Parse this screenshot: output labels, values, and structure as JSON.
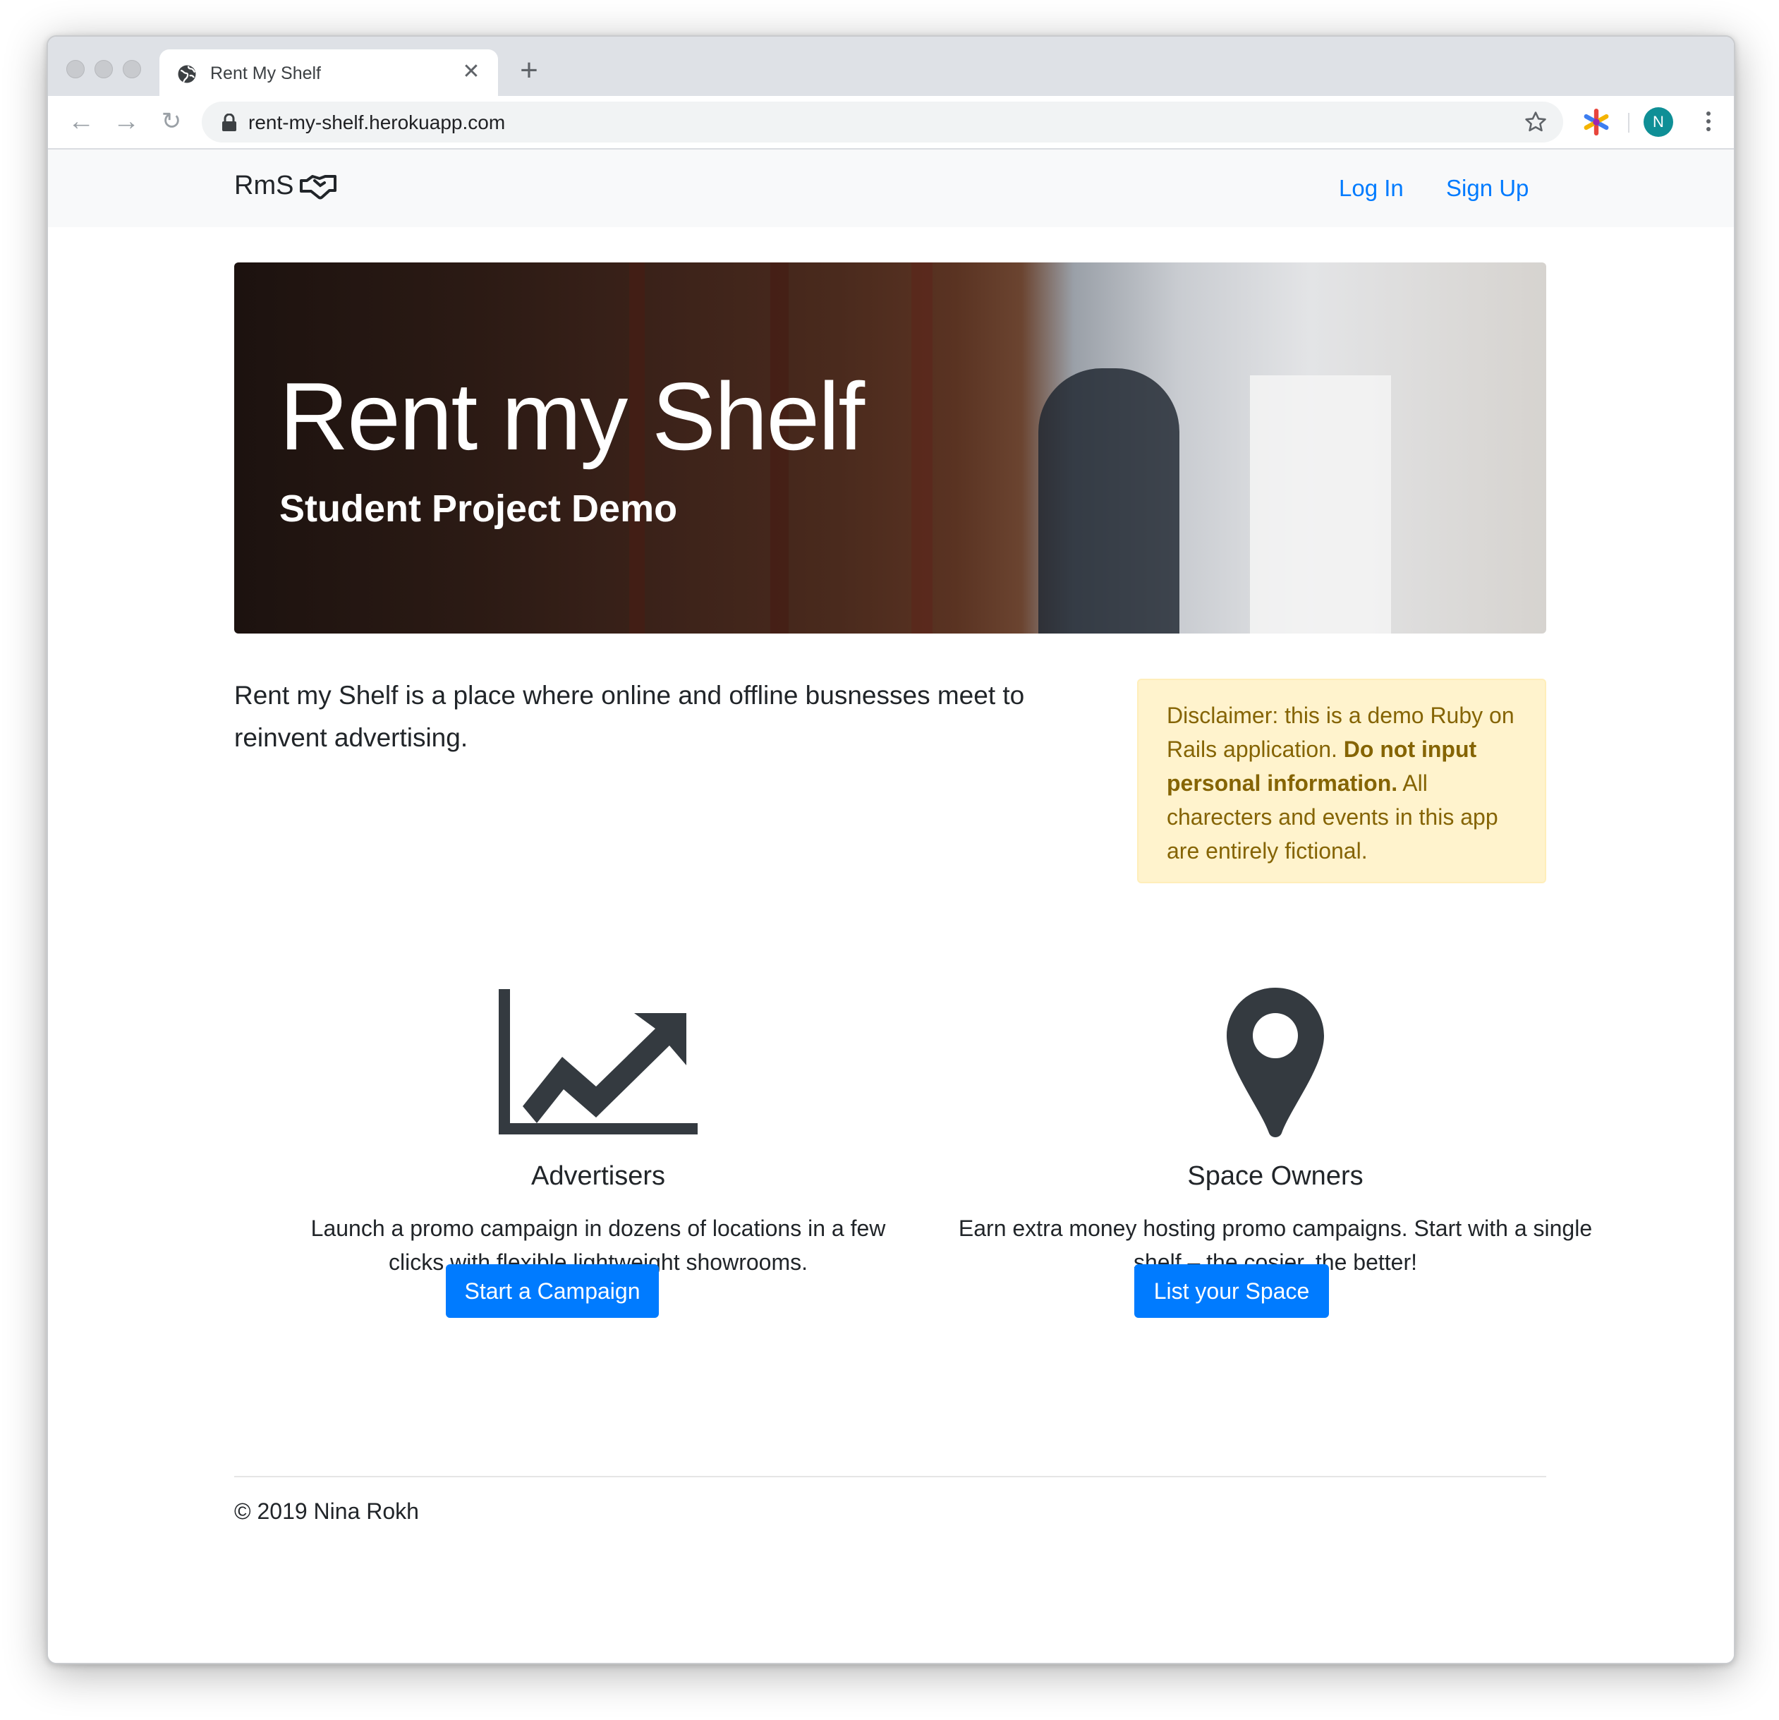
{
  "browser": {
    "tab_title": "Rent My Shelf",
    "url": "rent-my-shelf.herokuapp.com",
    "profile_initial": "N"
  },
  "nav": {
    "brand": "RmS",
    "login": "Log In",
    "signup": "Sign Up"
  },
  "hero": {
    "title": "Rent my Shelf",
    "subtitle": "Student Project Demo"
  },
  "intro": {
    "lead": "Rent my Shelf is a place where online and offline busnesses meet to reinvent advertising."
  },
  "alert": {
    "text_before": "Disclaimer: this is a demo Ruby on Rails application. ",
    "bold": "Do not input personal information.",
    "text_after": " All charecters and events in this app are entirely fictional."
  },
  "features": [
    {
      "icon": "chart-line-icon",
      "title": "Advertisers",
      "description": "Launch a promo campaign in dozens of locations in a few clicks with flexible lightweight showrooms.",
      "button": "Start a Campaign"
    },
    {
      "icon": "map-marker-icon",
      "title": "Space Owners",
      "description": "Earn extra money hosting promo campaigns. Start with a single shelf – the cosier, the better!",
      "button": "List your Space"
    }
  ],
  "footer": {
    "copyright": "© 2019 Nina Rokh"
  },
  "colors": {
    "primary": "#007bff",
    "alert_bg": "#fff3cd",
    "alert_text": "#856404",
    "navbar_bg": "#f8f9fa",
    "icon_dark": "#343a40"
  }
}
